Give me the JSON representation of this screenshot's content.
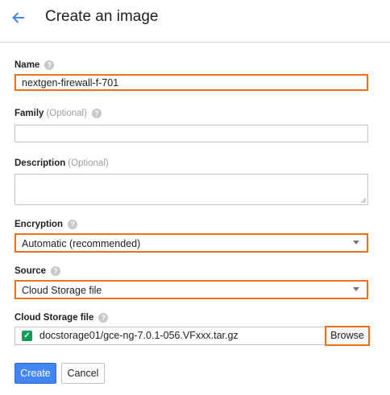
{
  "header": {
    "back_icon": "arrow-left-icon",
    "title": "Create an image",
    "accent_color": "#4285f4"
  },
  "form": {
    "name": {
      "label": "Name",
      "value": "nextgen-firewall-f-701"
    },
    "family": {
      "label": "Family",
      "optional": "(Optional)",
      "value": ""
    },
    "description": {
      "label": "Description",
      "optional": "(Optional)",
      "value": ""
    },
    "encryption": {
      "label": "Encryption",
      "value": "Automatic (recommended)"
    },
    "source": {
      "label": "Source",
      "value": "Cloud Storage file"
    },
    "cloud_storage_file": {
      "label": "Cloud Storage file",
      "value": "docstorage01/gce-ng-7.0.1-056.VFxxx.tar.gz",
      "browse_label": "Browse",
      "status_color": "#0f9d58"
    }
  },
  "actions": {
    "create_label": "Create",
    "cancel_label": "Cancel"
  },
  "highlight_color": "#e8711a"
}
